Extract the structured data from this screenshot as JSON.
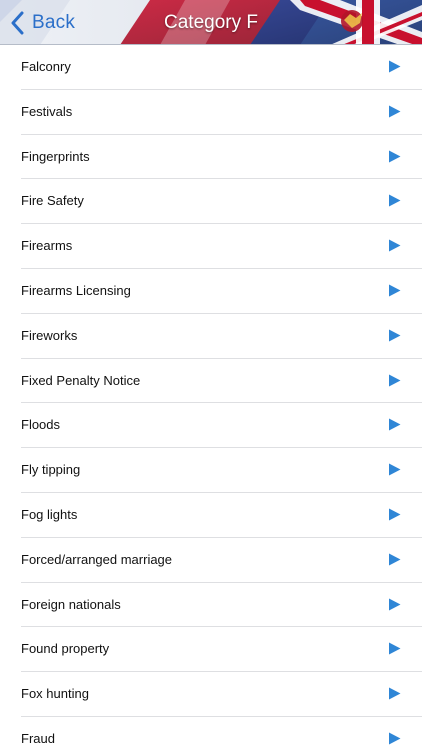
{
  "header": {
    "back_label": "Back",
    "title": "Category F"
  },
  "icons": {
    "back": "chevron-left-icon",
    "row_arrow": "play-arrow-icon"
  },
  "colors": {
    "accent": "#2b6fc9",
    "arrow": "#2f86d6"
  },
  "list": {
    "items": [
      {
        "label": "Falconry"
      },
      {
        "label": "Festivals"
      },
      {
        "label": "Fingerprints"
      },
      {
        "label": "Fire Safety"
      },
      {
        "label": "Firearms"
      },
      {
        "label": "Firearms Licensing"
      },
      {
        "label": "Fireworks"
      },
      {
        "label": "Fixed Penalty Notice"
      },
      {
        "label": "Floods"
      },
      {
        "label": "Fly tipping"
      },
      {
        "label": "Fog lights"
      },
      {
        "label": "Forced/arranged marriage"
      },
      {
        "label": "Foreign nationals"
      },
      {
        "label": "Found property"
      },
      {
        "label": "Fox hunting"
      },
      {
        "label": "Fraud"
      }
    ]
  }
}
